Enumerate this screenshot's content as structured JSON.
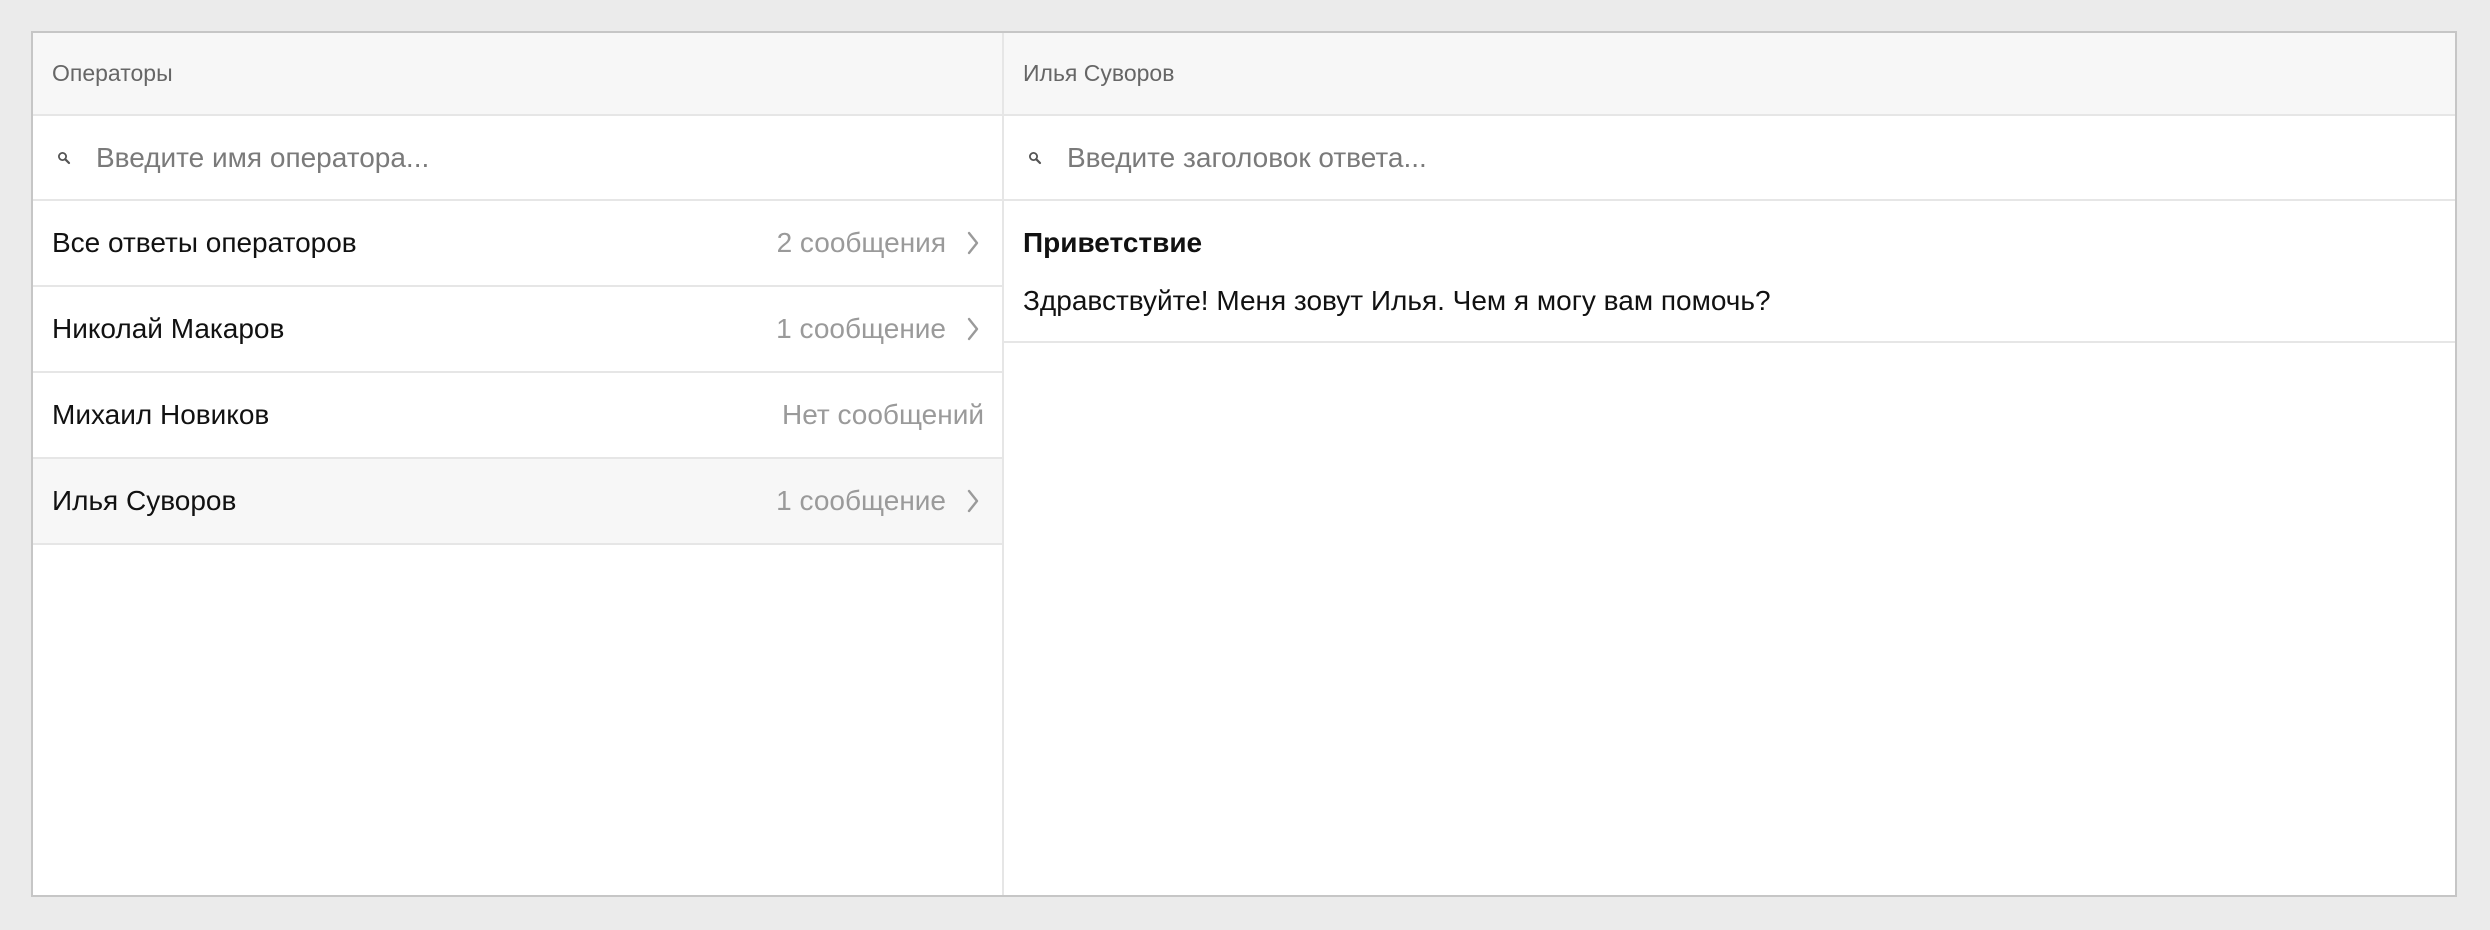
{
  "left_pane": {
    "header": "Операторы",
    "search_placeholder": "Введите имя оператора...",
    "operators": [
      {
        "name": "Все ответы операторов",
        "count": "2 сообщения",
        "has_chevron": true,
        "selected": false
      },
      {
        "name": "Николай Макаров",
        "count": "1 сообщение",
        "has_chevron": true,
        "selected": false
      },
      {
        "name": "Михаил Новиков",
        "count": "Нет сообщений",
        "has_chevron": false,
        "selected": false
      },
      {
        "name": "Илья Суворов",
        "count": "1 сообщение",
        "has_chevron": true,
        "selected": true
      }
    ]
  },
  "right_pane": {
    "header": "Илья Суворов",
    "search_placeholder": "Введите заголовок ответа...",
    "replies": [
      {
        "title": "Приветствие",
        "text": "Здравствуйте! Меня зовут Илья. Чем я могу вам помочь?"
      }
    ]
  },
  "icons": {
    "search": "search-icon",
    "chevron": "chevron-right-icon"
  },
  "colors": {
    "background": "#ebebeb",
    "header_bg": "#f7f7f7",
    "selected_row_bg": "#f7f7f7",
    "border": "#e6e6e6",
    "muted_text": "#9a9a9a"
  }
}
